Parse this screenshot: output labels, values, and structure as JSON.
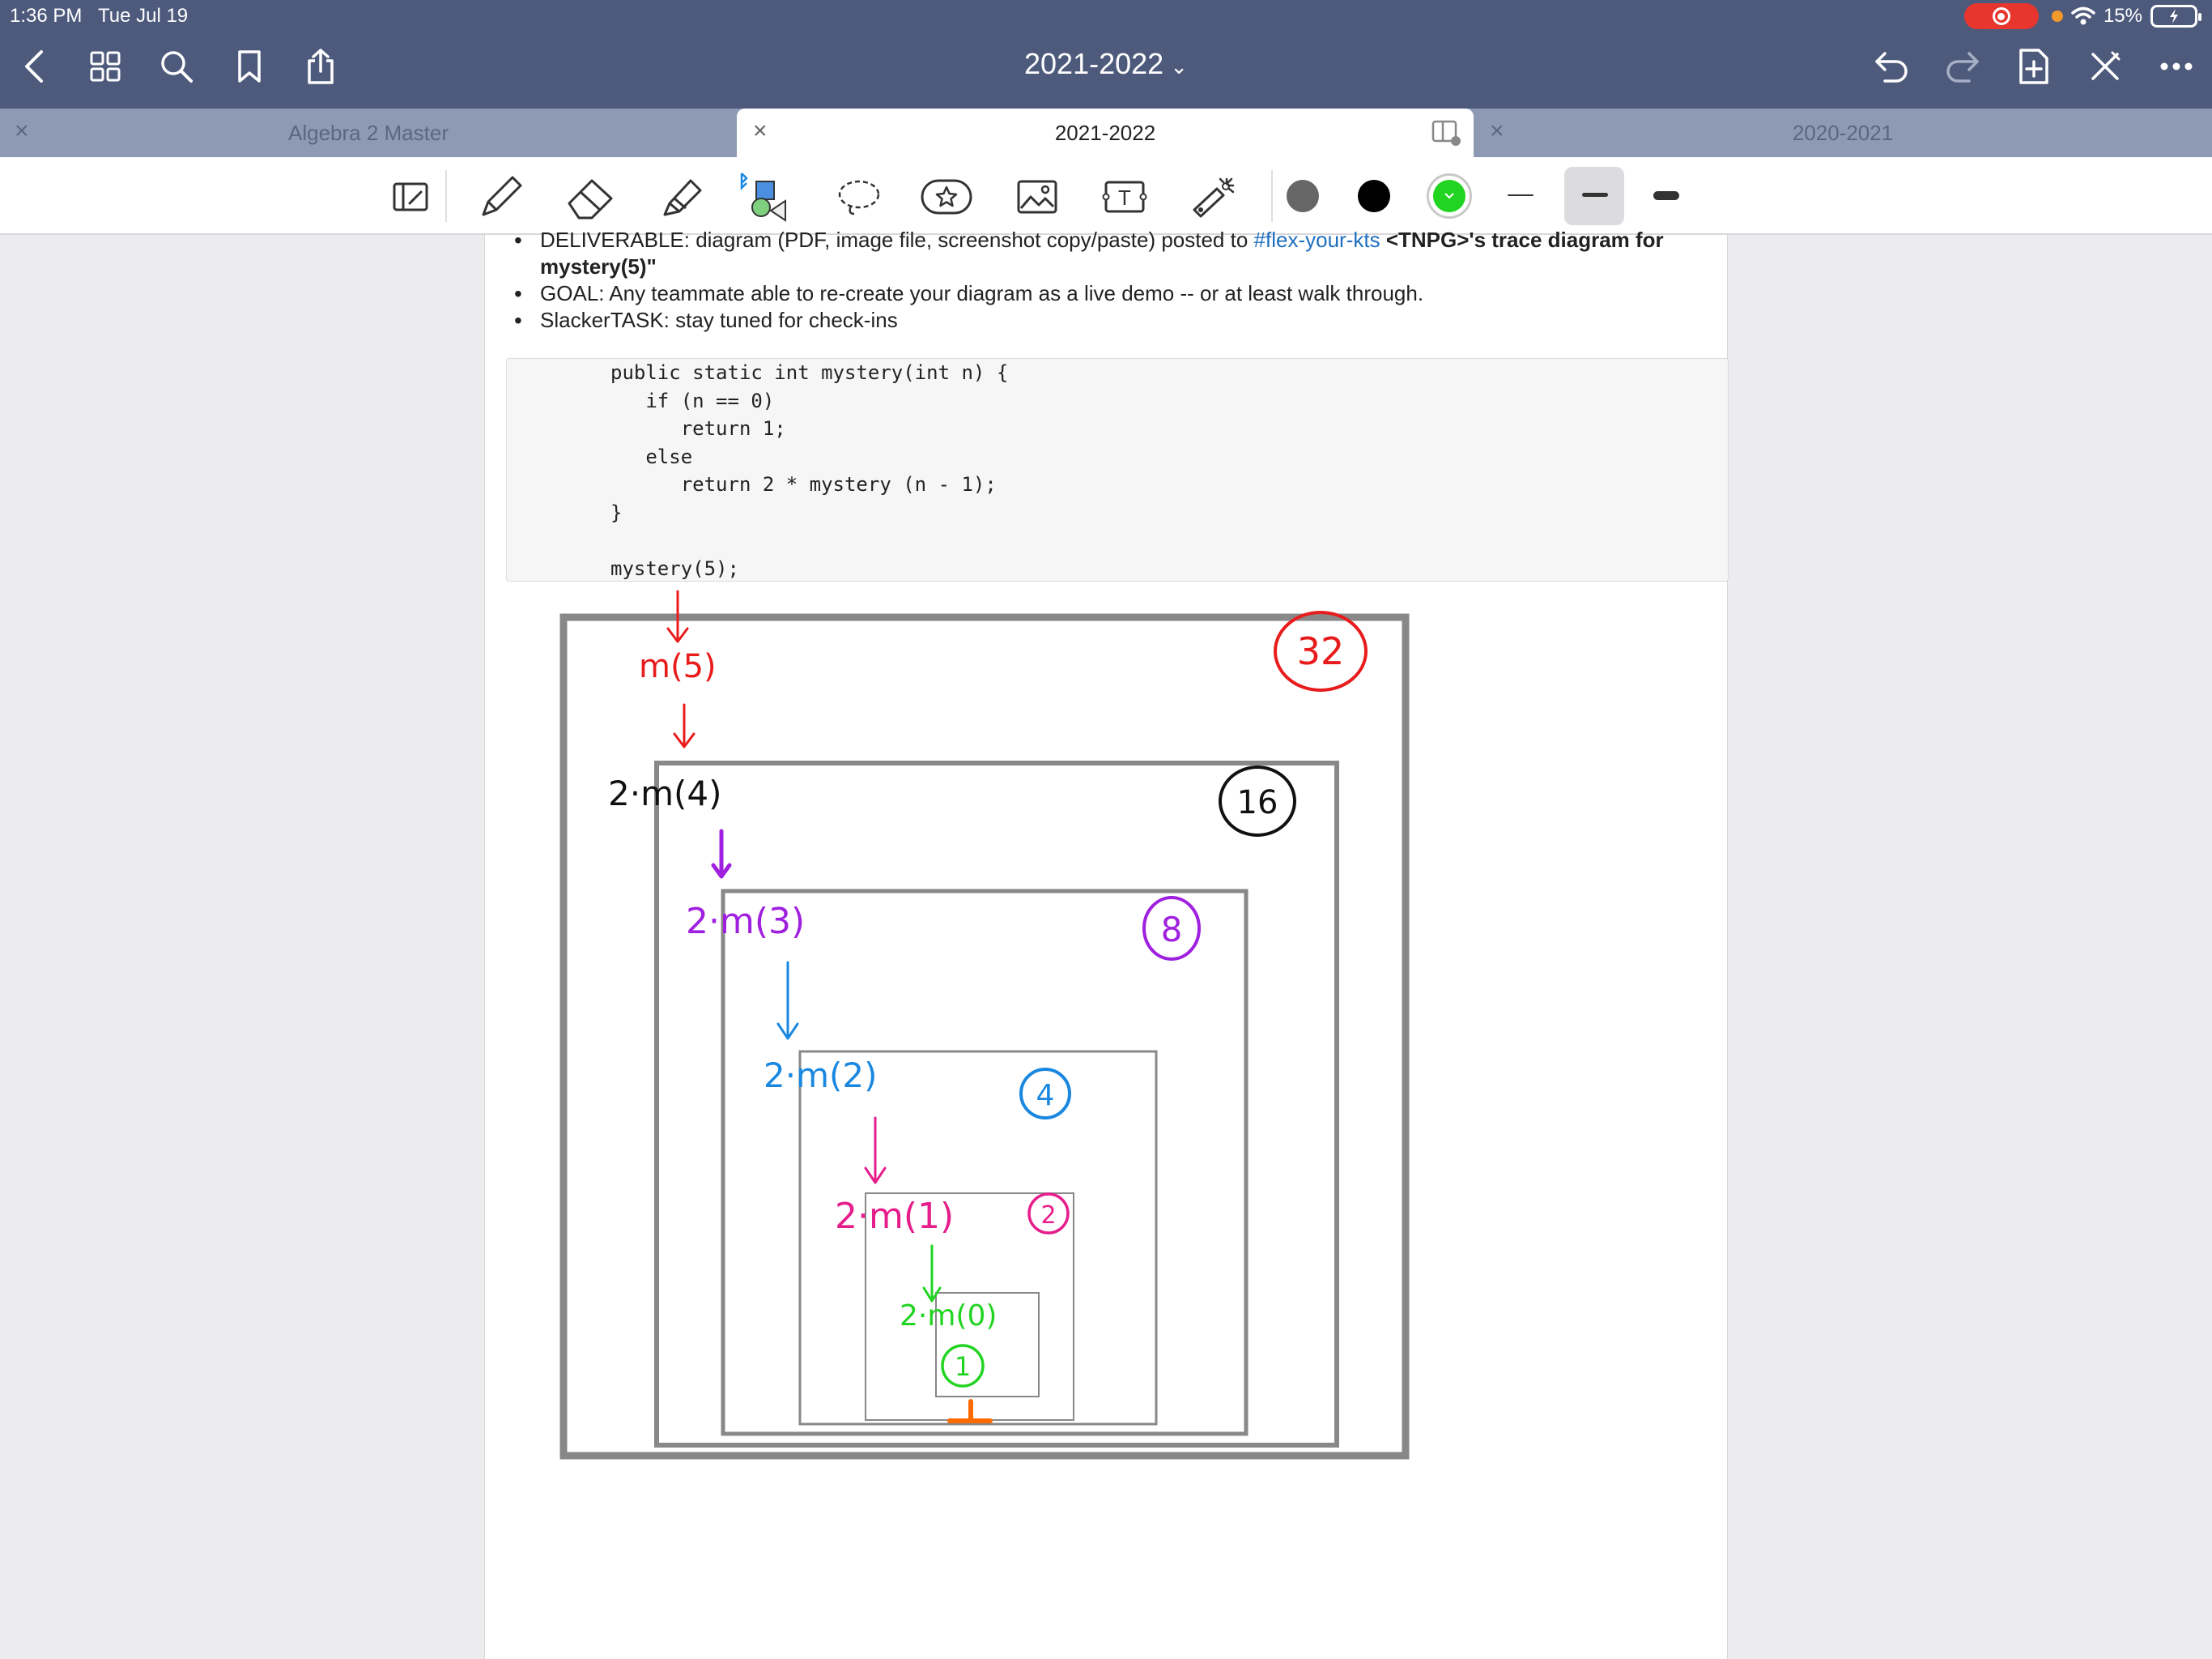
{
  "status_bar": {
    "time": "1:36 PM",
    "date": "Tue Jul 19",
    "battery": "15%"
  },
  "nav": {
    "title": "2021-2022"
  },
  "tabs": [
    {
      "label": "Algebra 2  Master",
      "active": false
    },
    {
      "label": "2021-2022",
      "active": true
    },
    {
      "label": "2020-2021",
      "active": false
    }
  ],
  "toolbar": {
    "colors": [
      "#666666",
      "#000000",
      "#22d422"
    ],
    "text_tool_label": "T"
  },
  "document": {
    "bullets": [
      {
        "prefix": "DELIVERABLE: diagram (PDF, image file, screenshot copy/paste) posted to ",
        "link": "#flex-your-kts",
        "middle": " ",
        "bold": "<TNPG>'s trace diagram for mystery(5)\"",
        "suffix": ""
      },
      {
        "text": "GOAL: Any teammate able to re-create your diagram as a live demo -- or at least walk through."
      },
      {
        "text": "SlackerTASK: stay tuned for check-ins"
      }
    ],
    "code_lines": [
      "public static int mystery(int n) {",
      "   if (n == 0)",
      "      return 1;",
      "   else",
      "      return 2 * mystery (n - 1);",
      "}",
      "",
      "mystery(5);"
    ]
  },
  "diagram": {
    "frames": [
      {
        "call": "m(5)",
        "result": "32",
        "color": "#e81c1c"
      },
      {
        "call": "2·m(4)",
        "result": "16",
        "color": "#111111"
      },
      {
        "call": "2·m(3)",
        "result": "8",
        "color": "#a020e0"
      },
      {
        "call": "2·m(2)",
        "result": "4",
        "color": "#1a88e0"
      },
      {
        "call": "2·m(1)",
        "result": "2",
        "color": "#e61e8c"
      },
      {
        "call": "2·m(0)",
        "result": "1",
        "color": "#22d422"
      }
    ]
  }
}
